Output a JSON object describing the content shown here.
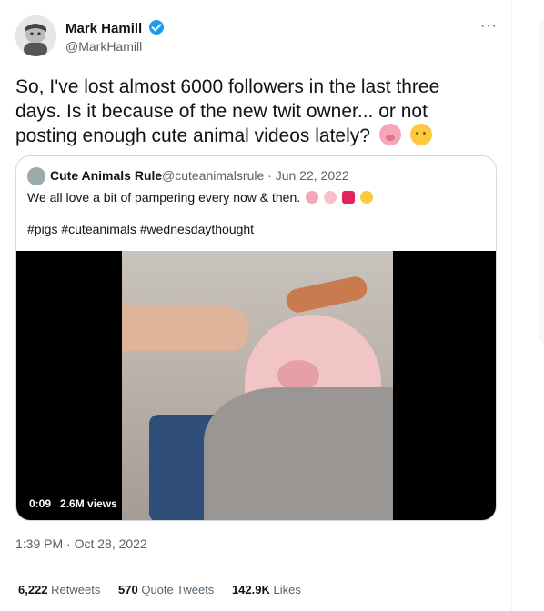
{
  "author": {
    "name": "Mark Hamill",
    "handle": "@MarkHamill"
  },
  "tweet_text": "So, I've lost almost 6000 followers in the last three days. Is it because of the new twit owner...  or not posting enough cute animal videos lately?",
  "quoted_tweet": {
    "name": "Cute Animals Rule",
    "handle": "@cuteanimalsrule",
    "date": "Jun 22, 2022",
    "text": "We all love a bit of pampering every now & then.",
    "hashtags": "#pigs #cuteanimals #wednesdaythought",
    "video": {
      "time": "0:09",
      "views": "2.6M views"
    }
  },
  "timestamp": "1:39 PM · Oct 28, 2022",
  "stats": {
    "retweets_count": "6,222",
    "retweets_label": "Retweets",
    "quotes_count": "570",
    "quotes_label": "Quote Tweets",
    "likes_count": "142.9K",
    "likes_label": "Likes"
  },
  "icons": {
    "verified": "verified-badge-icon",
    "more": "more-options-icon"
  },
  "colors": {
    "accent": "#1d9bf0",
    "secondary_text": "#536471"
  }
}
